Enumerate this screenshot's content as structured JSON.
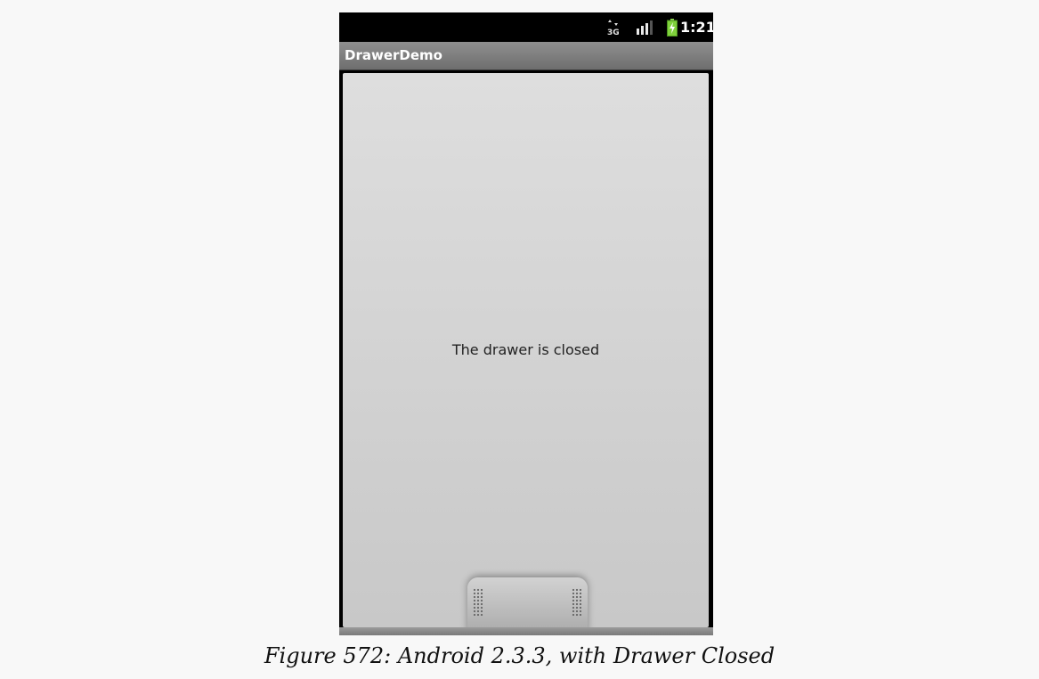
{
  "status_bar": {
    "network_type": "3G",
    "network_icon": "network-3g-icon",
    "signal_icon": "signal-bars-icon",
    "battery_icon": "battery-charging-icon",
    "time": "1:21"
  },
  "app": {
    "title": "DrawerDemo"
  },
  "content": {
    "message": "The drawer is closed"
  },
  "drawer": {
    "state": "closed",
    "handle_icon": "drawer-grip-icon"
  },
  "caption": "Figure 572: Android 2.3.3, with Drawer Closed"
}
